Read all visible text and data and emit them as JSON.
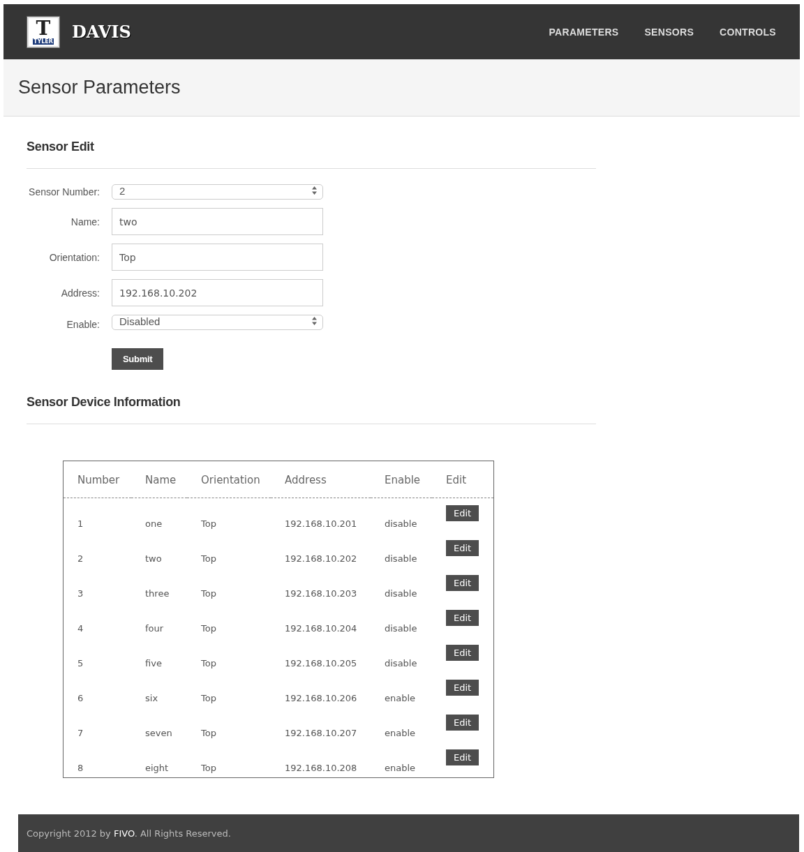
{
  "navbar": {
    "logo": {
      "letter": "T",
      "banner": "TYLER"
    },
    "brand": "DAVIS",
    "links": [
      {
        "label": "PARAMETERS"
      },
      {
        "label": "SENSORS"
      },
      {
        "label": "CONTROLS"
      }
    ]
  },
  "page_title": "Sensor Parameters",
  "edit_section": {
    "title": "Sensor Edit",
    "fields": [
      {
        "kind": "select",
        "label": "Sensor Number:",
        "value": "2"
      },
      {
        "kind": "text",
        "label": "Name:",
        "value": "two"
      },
      {
        "kind": "text",
        "label": "Orientation:",
        "value": "Top"
      },
      {
        "kind": "text",
        "label": "Address:",
        "value": "192.168.10.202"
      },
      {
        "kind": "select",
        "label": "Enable:",
        "value": "Disabled"
      }
    ],
    "submit": "Submit"
  },
  "info_section": {
    "title": "Sensor Device Information"
  },
  "table": {
    "columns": [
      "Number",
      "Name",
      "Orientation",
      "Address",
      "Enable",
      "Edit"
    ],
    "rows": [
      {
        "number": "1",
        "name": "one",
        "orientation": "Top",
        "address": "192.168.10.201",
        "enable": "disable",
        "edit": "Edit"
      },
      {
        "number": "2",
        "name": "two",
        "orientation": "Top",
        "address": "192.168.10.202",
        "enable": "disable",
        "edit": "Edit"
      },
      {
        "number": "3",
        "name": "three",
        "orientation": "Top",
        "address": "192.168.10.203",
        "enable": "disable",
        "edit": "Edit"
      },
      {
        "number": "4",
        "name": "four",
        "orientation": "Top",
        "address": "192.168.10.204",
        "enable": "disable",
        "edit": "Edit"
      },
      {
        "number": "5",
        "name": "five",
        "orientation": "Top",
        "address": "192.168.10.205",
        "enable": "disable",
        "edit": "Edit"
      },
      {
        "number": "6",
        "name": "six",
        "orientation": "Top",
        "address": "192.168.10.206",
        "enable": "enable",
        "edit": "Edit"
      },
      {
        "number": "7",
        "name": "seven",
        "orientation": "Top",
        "address": "192.168.10.207",
        "enable": "enable",
        "edit": "Edit"
      },
      {
        "number": "8",
        "name": "eight",
        "orientation": "Top",
        "address": "192.168.10.208",
        "enable": "enable",
        "edit": "Edit"
      }
    ]
  },
  "footer": "Copyright 2012 by **FIVO**. All Rights Reserved."
}
